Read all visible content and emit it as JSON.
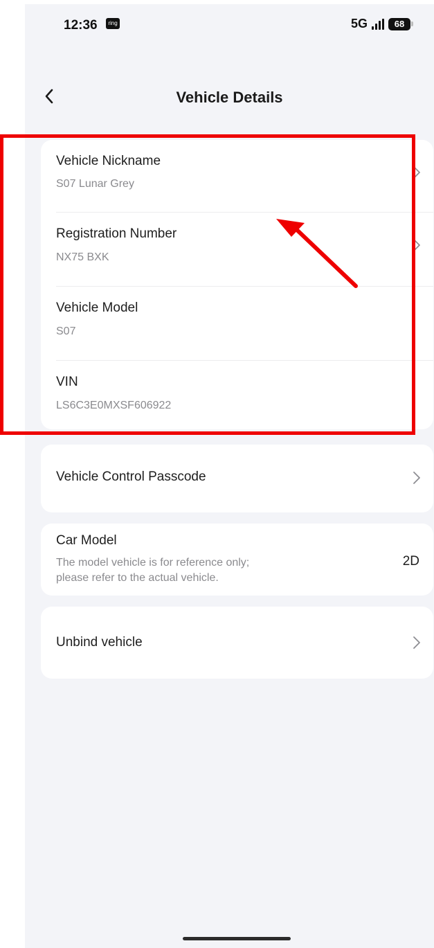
{
  "status_bar": {
    "time": "12:36",
    "app_icon_label": "ring",
    "network": "5G",
    "battery": "68"
  },
  "header": {
    "title": "Vehicle Details",
    "back_icon": "chevron-left-icon"
  },
  "vehicle_info": [
    {
      "title": "Vehicle Nickname",
      "value": "S07 Lunar Grey",
      "has_chevron": true
    },
    {
      "title": "Registration Number",
      "value": "NX75 BXK",
      "has_chevron": true
    },
    {
      "title": "Vehicle Model",
      "value": "S07",
      "has_chevron": false
    },
    {
      "title": "VIN",
      "value": "LS6C3E0MXSF606922",
      "has_chevron": false
    }
  ],
  "passcode": {
    "label": "Vehicle Control Passcode"
  },
  "car_model": {
    "title": "Car Model",
    "description_line1": "The model vehicle is for reference only;",
    "description_line2": "please refer to the actual vehicle.",
    "value": "2D"
  },
  "unbind": {
    "label": "Unbind vehicle"
  },
  "colors": {
    "background": "#f3f4f8",
    "card": "#ffffff",
    "annotation": "#ee0000",
    "secondary_text": "#8a8a8e"
  }
}
